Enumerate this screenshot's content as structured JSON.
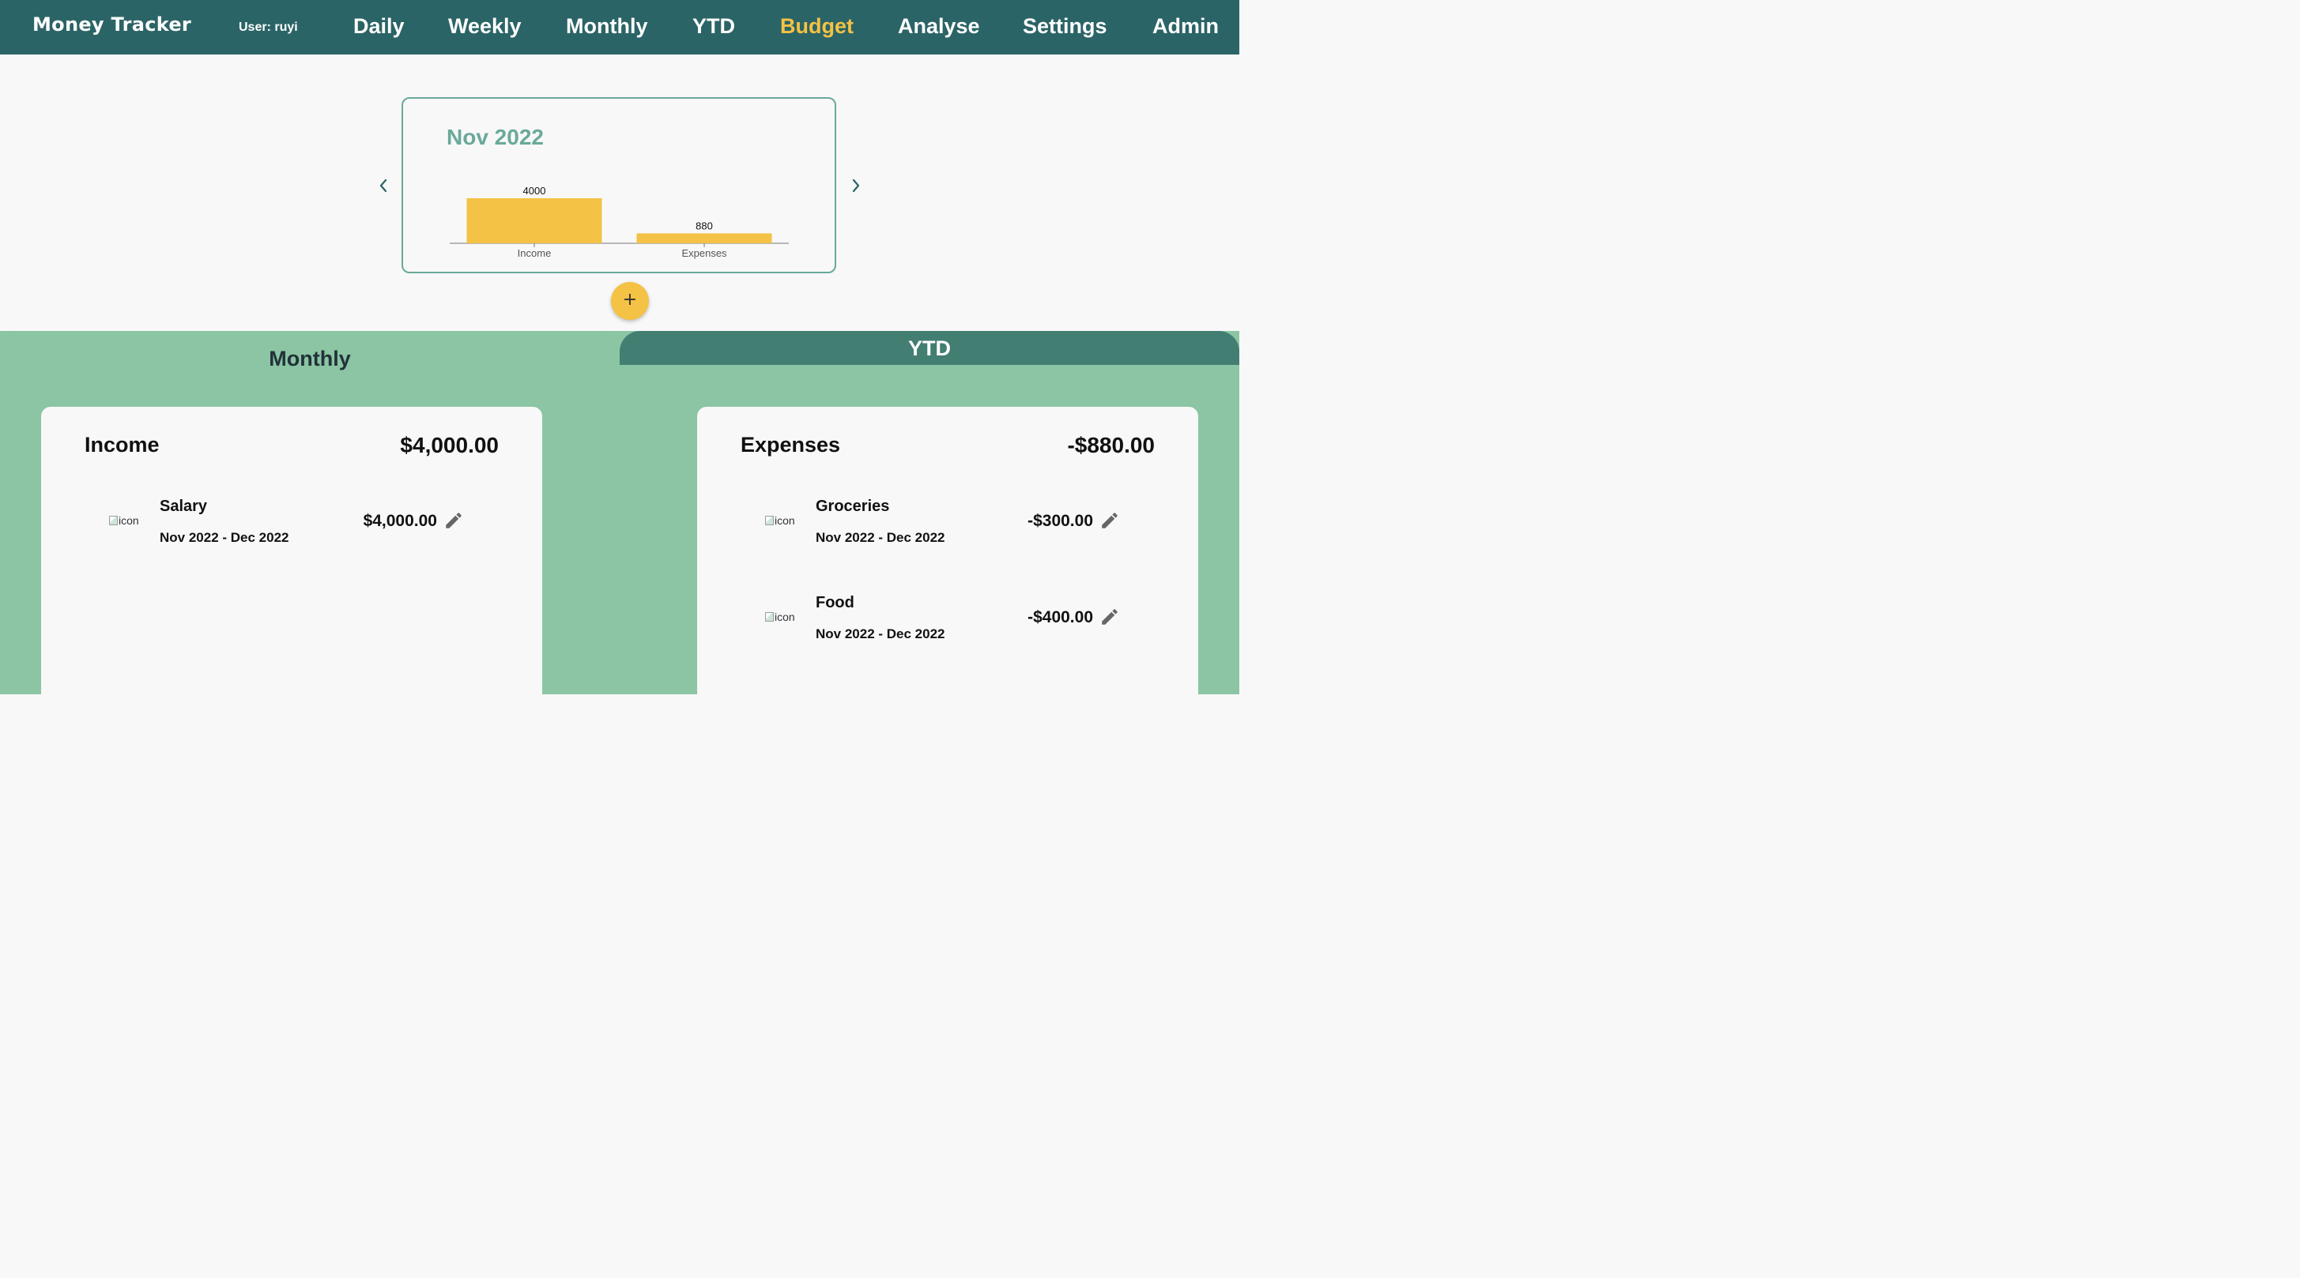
{
  "nav": {
    "brand": "Money Tracker",
    "user": "User: ruyi",
    "links": [
      "Daily",
      "Weekly",
      "Monthly",
      "YTD",
      "Budget",
      "Analyse",
      "Settings",
      "Admin"
    ],
    "active": "Budget"
  },
  "chart": {
    "title": "Nov 2022",
    "prev_icon": "chevron-left-icon",
    "next_icon": "chevron-right-icon"
  },
  "chart_data": {
    "type": "bar",
    "categories": [
      "Income",
      "Expenses"
    ],
    "values": [
      4000,
      880
    ],
    "data_labels": [
      "4000",
      "880"
    ],
    "title": "Nov 2022",
    "bar_color": "#f4c244"
  },
  "fab": {
    "label": "+"
  },
  "tabs": {
    "monthly": "Monthly",
    "ytd": "YTD",
    "active": "Monthly"
  },
  "income": {
    "title": "Income",
    "total": "$4,000.00",
    "items": [
      {
        "icon_alt": "icon",
        "name": "Salary",
        "period": "Nov 2022 - Dec 2022",
        "amount": "$4,000.00"
      }
    ]
  },
  "expenses": {
    "title": "Expenses",
    "total": "-$880.00",
    "items": [
      {
        "icon_alt": "icon",
        "name": "Groceries",
        "period": "Nov 2022 - Dec 2022",
        "amount": "-$300.00"
      },
      {
        "icon_alt": "icon",
        "name": "Food",
        "period": "Nov 2022 - Dec 2022",
        "amount": "-$400.00"
      }
    ]
  },
  "colors": {
    "nav_bg": "#2b6466",
    "accent": "#f4c244",
    "panel": "#8bc5a3",
    "tab_inactive": "#437e72",
    "chart_border": "#6aa99a"
  }
}
